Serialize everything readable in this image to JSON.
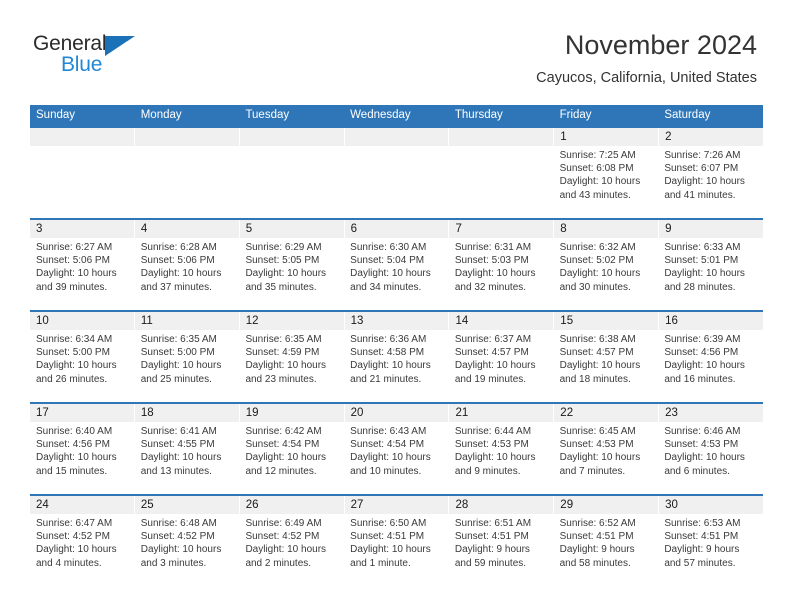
{
  "brand": {
    "name_part1": "General",
    "name_part2": "Blue",
    "triangle_icon": "blue-triangle-icon",
    "colors": {
      "dark": "#2b2b2b",
      "blue": "#2288d6",
      "triangle": "#1b72b8"
    }
  },
  "header": {
    "month_title": "November 2024",
    "location": "Cayucos, California, United States"
  },
  "theme": {
    "header_bar": "#2f76b8",
    "date_band": "#f0f0f0",
    "week_divider": "#2f76b8",
    "text": "#3a3a3a"
  },
  "calendar": {
    "weekday_headers": [
      "Sunday",
      "Monday",
      "Tuesday",
      "Wednesday",
      "Thursday",
      "Friday",
      "Saturday"
    ],
    "weeks": [
      {
        "days": [
          {
            "date": "",
            "sunrise": "",
            "sunset": "",
            "daylight_line1": "",
            "daylight_line2": "",
            "empty": true
          },
          {
            "date": "",
            "sunrise": "",
            "sunset": "",
            "daylight_line1": "",
            "daylight_line2": "",
            "empty": true
          },
          {
            "date": "",
            "sunrise": "",
            "sunset": "",
            "daylight_line1": "",
            "daylight_line2": "",
            "empty": true
          },
          {
            "date": "",
            "sunrise": "",
            "sunset": "",
            "daylight_line1": "",
            "daylight_line2": "",
            "empty": true
          },
          {
            "date": "",
            "sunrise": "",
            "sunset": "",
            "daylight_line1": "",
            "daylight_line2": "",
            "empty": true
          },
          {
            "date": "1",
            "sunrise": "Sunrise: 7:25 AM",
            "sunset": "Sunset: 6:08 PM",
            "daylight_line1": "Daylight: 10 hours",
            "daylight_line2": "and 43 minutes.",
            "empty": false
          },
          {
            "date": "2",
            "sunrise": "Sunrise: 7:26 AM",
            "sunset": "Sunset: 6:07 PM",
            "daylight_line1": "Daylight: 10 hours",
            "daylight_line2": "and 41 minutes.",
            "empty": false
          }
        ]
      },
      {
        "days": [
          {
            "date": "3",
            "sunrise": "Sunrise: 6:27 AM",
            "sunset": "Sunset: 5:06 PM",
            "daylight_line1": "Daylight: 10 hours",
            "daylight_line2": "and 39 minutes.",
            "empty": false
          },
          {
            "date": "4",
            "sunrise": "Sunrise: 6:28 AM",
            "sunset": "Sunset: 5:06 PM",
            "daylight_line1": "Daylight: 10 hours",
            "daylight_line2": "and 37 minutes.",
            "empty": false
          },
          {
            "date": "5",
            "sunrise": "Sunrise: 6:29 AM",
            "sunset": "Sunset: 5:05 PM",
            "daylight_line1": "Daylight: 10 hours",
            "daylight_line2": "and 35 minutes.",
            "empty": false
          },
          {
            "date": "6",
            "sunrise": "Sunrise: 6:30 AM",
            "sunset": "Sunset: 5:04 PM",
            "daylight_line1": "Daylight: 10 hours",
            "daylight_line2": "and 34 minutes.",
            "empty": false
          },
          {
            "date": "7",
            "sunrise": "Sunrise: 6:31 AM",
            "sunset": "Sunset: 5:03 PM",
            "daylight_line1": "Daylight: 10 hours",
            "daylight_line2": "and 32 minutes.",
            "empty": false
          },
          {
            "date": "8",
            "sunrise": "Sunrise: 6:32 AM",
            "sunset": "Sunset: 5:02 PM",
            "daylight_line1": "Daylight: 10 hours",
            "daylight_line2": "and 30 minutes.",
            "empty": false
          },
          {
            "date": "9",
            "sunrise": "Sunrise: 6:33 AM",
            "sunset": "Sunset: 5:01 PM",
            "daylight_line1": "Daylight: 10 hours",
            "daylight_line2": "and 28 minutes.",
            "empty": false
          }
        ]
      },
      {
        "days": [
          {
            "date": "10",
            "sunrise": "Sunrise: 6:34 AM",
            "sunset": "Sunset: 5:00 PM",
            "daylight_line1": "Daylight: 10 hours",
            "daylight_line2": "and 26 minutes.",
            "empty": false
          },
          {
            "date": "11",
            "sunrise": "Sunrise: 6:35 AM",
            "sunset": "Sunset: 5:00 PM",
            "daylight_line1": "Daylight: 10 hours",
            "daylight_line2": "and 25 minutes.",
            "empty": false
          },
          {
            "date": "12",
            "sunrise": "Sunrise: 6:35 AM",
            "sunset": "Sunset: 4:59 PM",
            "daylight_line1": "Daylight: 10 hours",
            "daylight_line2": "and 23 minutes.",
            "empty": false
          },
          {
            "date": "13",
            "sunrise": "Sunrise: 6:36 AM",
            "sunset": "Sunset: 4:58 PM",
            "daylight_line1": "Daylight: 10 hours",
            "daylight_line2": "and 21 minutes.",
            "empty": false
          },
          {
            "date": "14",
            "sunrise": "Sunrise: 6:37 AM",
            "sunset": "Sunset: 4:57 PM",
            "daylight_line1": "Daylight: 10 hours",
            "daylight_line2": "and 19 minutes.",
            "empty": false
          },
          {
            "date": "15",
            "sunrise": "Sunrise: 6:38 AM",
            "sunset": "Sunset: 4:57 PM",
            "daylight_line1": "Daylight: 10 hours",
            "daylight_line2": "and 18 minutes.",
            "empty": false
          },
          {
            "date": "16",
            "sunrise": "Sunrise: 6:39 AM",
            "sunset": "Sunset: 4:56 PM",
            "daylight_line1": "Daylight: 10 hours",
            "daylight_line2": "and 16 minutes.",
            "empty": false
          }
        ]
      },
      {
        "days": [
          {
            "date": "17",
            "sunrise": "Sunrise: 6:40 AM",
            "sunset": "Sunset: 4:56 PM",
            "daylight_line1": "Daylight: 10 hours",
            "daylight_line2": "and 15 minutes.",
            "empty": false
          },
          {
            "date": "18",
            "sunrise": "Sunrise: 6:41 AM",
            "sunset": "Sunset: 4:55 PM",
            "daylight_line1": "Daylight: 10 hours",
            "daylight_line2": "and 13 minutes.",
            "empty": false
          },
          {
            "date": "19",
            "sunrise": "Sunrise: 6:42 AM",
            "sunset": "Sunset: 4:54 PM",
            "daylight_line1": "Daylight: 10 hours",
            "daylight_line2": "and 12 minutes.",
            "empty": false
          },
          {
            "date": "20",
            "sunrise": "Sunrise: 6:43 AM",
            "sunset": "Sunset: 4:54 PM",
            "daylight_line1": "Daylight: 10 hours",
            "daylight_line2": "and 10 minutes.",
            "empty": false
          },
          {
            "date": "21",
            "sunrise": "Sunrise: 6:44 AM",
            "sunset": "Sunset: 4:53 PM",
            "daylight_line1": "Daylight: 10 hours",
            "daylight_line2": "and 9 minutes.",
            "empty": false
          },
          {
            "date": "22",
            "sunrise": "Sunrise: 6:45 AM",
            "sunset": "Sunset: 4:53 PM",
            "daylight_line1": "Daylight: 10 hours",
            "daylight_line2": "and 7 minutes.",
            "empty": false
          },
          {
            "date": "23",
            "sunrise": "Sunrise: 6:46 AM",
            "sunset": "Sunset: 4:53 PM",
            "daylight_line1": "Daylight: 10 hours",
            "daylight_line2": "and 6 minutes.",
            "empty": false
          }
        ]
      },
      {
        "days": [
          {
            "date": "24",
            "sunrise": "Sunrise: 6:47 AM",
            "sunset": "Sunset: 4:52 PM",
            "daylight_line1": "Daylight: 10 hours",
            "daylight_line2": "and 4 minutes.",
            "empty": false
          },
          {
            "date": "25",
            "sunrise": "Sunrise: 6:48 AM",
            "sunset": "Sunset: 4:52 PM",
            "daylight_line1": "Daylight: 10 hours",
            "daylight_line2": "and 3 minutes.",
            "empty": false
          },
          {
            "date": "26",
            "sunrise": "Sunrise: 6:49 AM",
            "sunset": "Sunset: 4:52 PM",
            "daylight_line1": "Daylight: 10 hours",
            "daylight_line2": "and 2 minutes.",
            "empty": false
          },
          {
            "date": "27",
            "sunrise": "Sunrise: 6:50 AM",
            "sunset": "Sunset: 4:51 PM",
            "daylight_line1": "Daylight: 10 hours",
            "daylight_line2": "and 1 minute.",
            "empty": false
          },
          {
            "date": "28",
            "sunrise": "Sunrise: 6:51 AM",
            "sunset": "Sunset: 4:51 PM",
            "daylight_line1": "Daylight: 9 hours",
            "daylight_line2": "and 59 minutes.",
            "empty": false
          },
          {
            "date": "29",
            "sunrise": "Sunrise: 6:52 AM",
            "sunset": "Sunset: 4:51 PM",
            "daylight_line1": "Daylight: 9 hours",
            "daylight_line2": "and 58 minutes.",
            "empty": false
          },
          {
            "date": "30",
            "sunrise": "Sunrise: 6:53 AM",
            "sunset": "Sunset: 4:51 PM",
            "daylight_line1": "Daylight: 9 hours",
            "daylight_line2": "and 57 minutes.",
            "empty": false
          }
        ]
      }
    ]
  }
}
